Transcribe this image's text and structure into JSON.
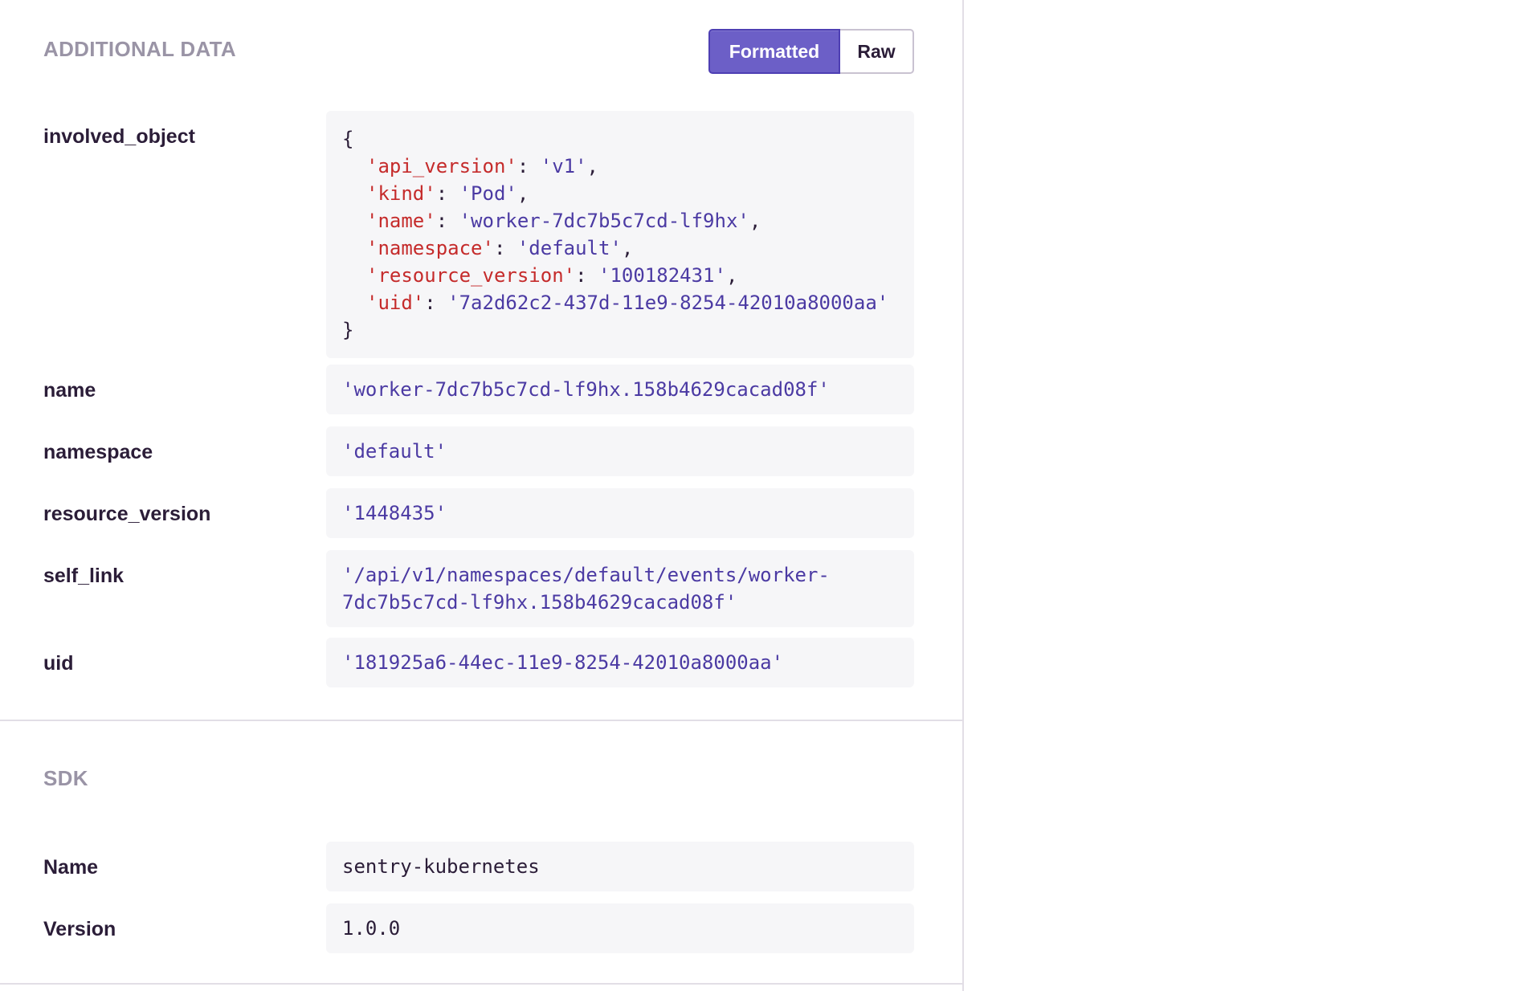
{
  "additional_data": {
    "title": "ADDITIONAL DATA",
    "toggle": {
      "formatted_label": "Formatted",
      "raw_label": "Raw",
      "active": "Formatted"
    },
    "involved_object": {
      "key": "involved_object",
      "open_brace": "{",
      "close_brace": "}",
      "fields": [
        {
          "key": "'api_version'",
          "value": "'v1'",
          "sep": ": ",
          "trail": ","
        },
        {
          "key": "'kind'",
          "value": "'Pod'",
          "sep": ": ",
          "trail": ","
        },
        {
          "key": "'name'",
          "value": "'worker-7dc7b5c7cd-lf9hx'",
          "sep": ": ",
          "trail": ","
        },
        {
          "key": "'namespace'",
          "value": "'default'",
          "sep": ": ",
          "trail": ","
        },
        {
          "key": "'resource_version'",
          "value": "'100182431'",
          "sep": ": ",
          "trail": ","
        },
        {
          "key": "'uid'",
          "value": "'7a2d62c2-437d-11e9-8254-42010a8000aa'",
          "sep": ": ",
          "trail": ""
        }
      ]
    },
    "rows": [
      {
        "key": "name",
        "value": "'worker-7dc7b5c7cd-lf9hx.158b4629cacad08f'"
      },
      {
        "key": "namespace",
        "value": "'default'"
      },
      {
        "key": "resource_version",
        "value": "'1448435'"
      },
      {
        "key": "self_link",
        "value_line1": "'/api/v1/namespaces/default/events/worker-",
        "value_line2": "7dc7b5c7cd-lf9hx.158b4629cacad08f'"
      },
      {
        "key": "uid",
        "value": "'181925a6-44ec-11e9-8254-42010a8000aa'"
      }
    ]
  },
  "sdk": {
    "title": "SDK",
    "rows": [
      {
        "key": "Name",
        "value": "sentry-kubernetes"
      },
      {
        "key": "Version",
        "value": "1.0.0"
      }
    ]
  },
  "colors": {
    "accent": "#6c5fc7",
    "string": "#4b3aa3",
    "json_key": "#c52b2b",
    "muted_title": "#9a94a6",
    "value_bg": "#f6f6f8"
  }
}
